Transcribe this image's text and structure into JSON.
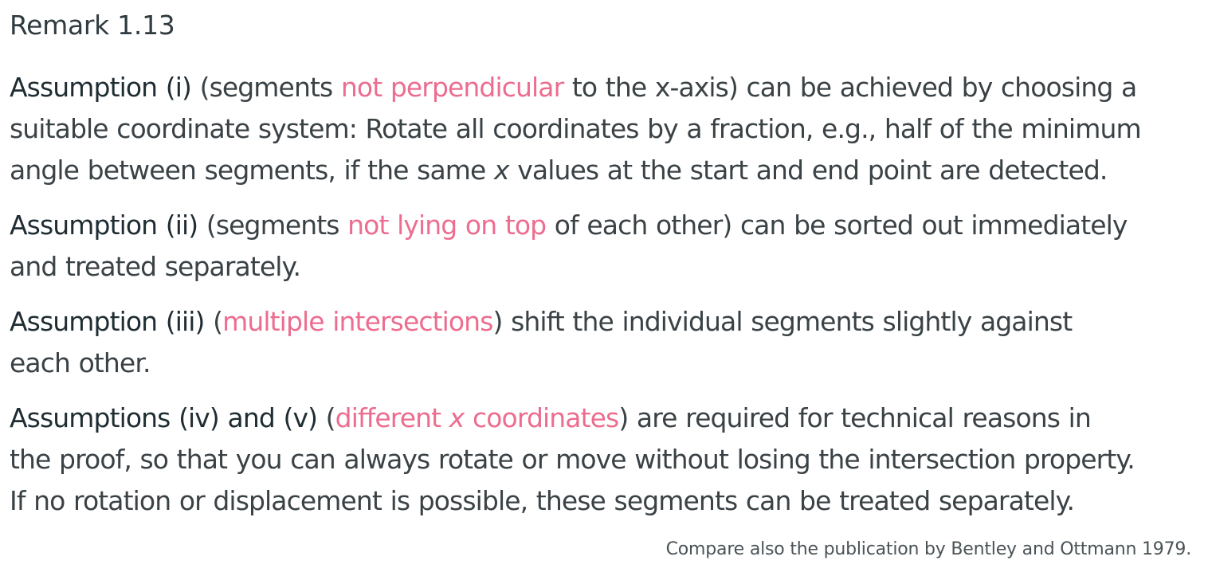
{
  "title": "Remark 1.13",
  "paragraphs": [
    {
      "label": "Assumption (i)",
      "open": " (segments ",
      "highlight": "not perpendicular",
      "line1_rest": " to the x-axis) can be achieved by choosing a",
      "line2": "suitable coordinate system: Rotate all coordinates by a fraction, e.g., half of the minimum",
      "line3_pre": "angle between segments, if the same ",
      "line3_var": "x",
      "line3_post": " values at the start and end point are detected."
    },
    {
      "label": "Assumption (ii)",
      "open": " (segments ",
      "highlight": "not lying on top",
      "line1_rest": " of each other) can be sorted out immediately",
      "line2": "and treated separately."
    },
    {
      "label": "Assumption (iii)",
      "open": " (",
      "highlight": "multiple intersections",
      "line1_rest": ") shift the individual segments slightly against",
      "line2": "each other."
    },
    {
      "label": "Assumptions (iv) and (v)",
      "open": " (",
      "highlight_pre": "different ",
      "highlight_var": "x",
      "highlight_post": " coordinates",
      "line1_rest": ") are required for technical reasons in",
      "line2": "the proof, so that you can always rotate or move without losing the intersection property.",
      "line3": "If no rotation or displacement is possible, these segments can be treated separately."
    }
  ],
  "footnote": "Compare also the publication by Bentley and Ottmann 1979.",
  "colors": {
    "text": "#3a4246",
    "label": "#1f2d33",
    "highlight": "#ec6d8f"
  }
}
